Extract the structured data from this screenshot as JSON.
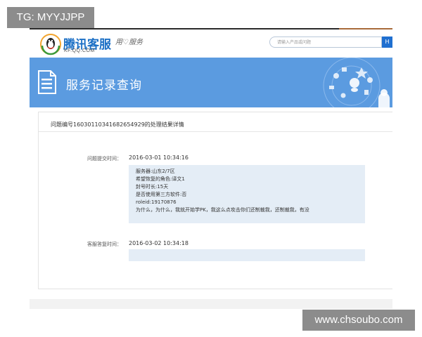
{
  "watermarks": {
    "top_left": "TG: MYYJJPP",
    "bottom_right": "www.chsoubo.com"
  },
  "header": {
    "logo_text": "腾讯客服",
    "logo_sub": "KF.QQ.COM",
    "slogan": "用♡服务",
    "search_placeholder": "请输入产品或问题",
    "search_button": "H"
  },
  "banner": {
    "title": "服务记录查询"
  },
  "record": {
    "title": "问题编号16030110341682654929的处理结果详情",
    "submit_label": "问题提交时间：",
    "submit_time": "2016-03-01 10:34:16",
    "details": [
      "服务器:山东2/7区",
      "希望恢复的角色:译文1",
      "封号时长:15天",
      "是否使用第三方软件:否",
      "roleid:19170876",
      "为什么，为什么，我就开始学PK，我这么点攻击你们还制裁我，还制裁我，有没"
    ],
    "reply_label": "客服答复时间：",
    "reply_time": "2016-03-02 10:34:18",
    "reply_text": ""
  },
  "colors": {
    "banner_bg": "#5b9be0",
    "detail_bg": "#e4edf6",
    "brand_blue": "#1b6fc5",
    "search_button_bg": "#1f6fd0",
    "watermark_bg": "#8c8c8c"
  },
  "icons": {
    "logo": "qq-penguin-logo-icon",
    "banner": "document-list-icon",
    "decoration": "service-icons-cluster"
  }
}
